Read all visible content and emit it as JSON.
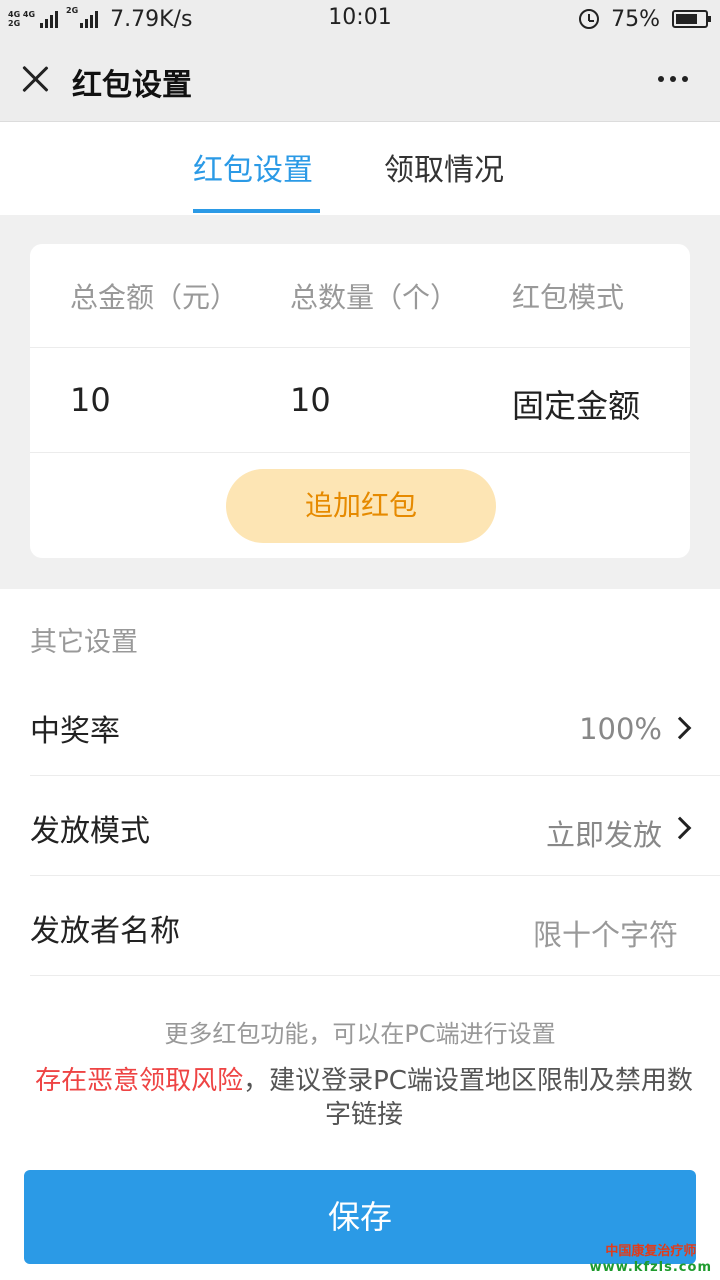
{
  "status_bar": {
    "net1": "4G 4G",
    "net2": "2G",
    "net3": "2G",
    "speed": "7.79K/s",
    "time": "10:01",
    "battery_percent": "75%",
    "battery_level": 0.75
  },
  "header": {
    "title": "红包设置",
    "close_icon": "close-icon",
    "more_icon": "more-icon"
  },
  "tabs": [
    {
      "label": "红包设置",
      "active": true
    },
    {
      "label": "领取情况",
      "active": false
    }
  ],
  "summary": {
    "headers": [
      "总金额（元）",
      "总数量（个）",
      "红包模式"
    ],
    "values": [
      "10",
      "10",
      "固定金额"
    ],
    "add_button": "追加红包"
  },
  "other_settings": {
    "title": "其它设置",
    "rows": [
      {
        "label": "中奖率",
        "value": "100%"
      },
      {
        "label": "发放模式",
        "value": "立即发放"
      },
      {
        "label": "发放者名称",
        "placeholder": "限十个字符"
      }
    ]
  },
  "hint": "更多红包功能，可以在PC端进行设置",
  "warning": {
    "red": "存在恶意领取风险",
    "rest": "，建议登录PC端设置地区限制及禁用数字链接"
  },
  "save_button": "保存",
  "watermark": {
    "line1": "中国康复治疗师",
    "line2": "www.kfzls.com"
  },
  "colors": {
    "accent": "#2b9ae6",
    "warning": "#ee4444",
    "add_button_bg": "#fde5b4",
    "add_button_text": "#e68a00"
  }
}
